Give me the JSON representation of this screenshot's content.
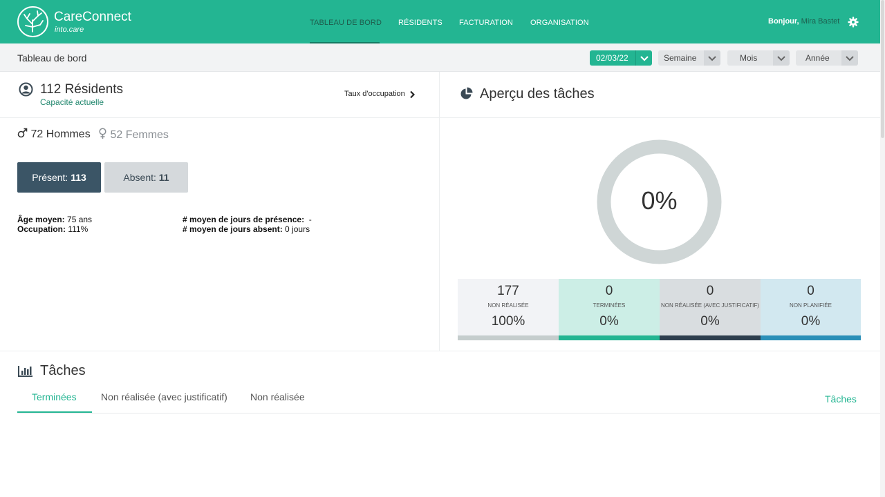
{
  "brand": {
    "name": "CareConnect",
    "sub": "into.care"
  },
  "nav": {
    "items": [
      {
        "label": "TABLEAU DE BORD",
        "active": true
      },
      {
        "label": "RÉSIDENTS",
        "active": false
      },
      {
        "label": "FACTURATION",
        "active": false
      },
      {
        "label": "ORGANISATION",
        "active": false
      }
    ]
  },
  "user": {
    "greeting": "Bonjour,",
    "name": "Mira Bastet"
  },
  "subbar": {
    "title": "Tableau de bord",
    "date": "02/03/22",
    "periods": [
      "Semaine",
      "Mois",
      "Année"
    ]
  },
  "residents": {
    "count_label": "112 Résidents",
    "capacity_label": "Capacité actuelle",
    "occupancy_link": "Taux d'occupation",
    "men": "72 Hommes",
    "women": "52 Femmes",
    "present_label": "Présent: ",
    "present_value": "113",
    "absent_label": "Absent: ",
    "absent_value": "11",
    "avg_age_label": "Âge moyen:",
    "avg_age_value": "75 ans",
    "occupation_label": "Occupation:",
    "occupation_value": "111%",
    "avg_presence_label": "# moyen de jours de présence:",
    "avg_presence_value": "-",
    "avg_absent_label": "# moyen de jours absent:",
    "avg_absent_value": "0 jours"
  },
  "overview": {
    "title": "Aperçu des tâches",
    "donut_label": "0%",
    "completion_fraction": 0,
    "tiles": [
      {
        "num": "177",
        "caption": "NON RÉALISÉE",
        "pct": "100%"
      },
      {
        "num": "0",
        "caption": "TERMINÉES",
        "pct": "0%"
      },
      {
        "num": "0",
        "caption": "NON RÉALISÉE (AVEC JUSTIFICATIF)",
        "pct": "0%"
      },
      {
        "num": "0",
        "caption": "NON PLANIFIÉE",
        "pct": "0%"
      }
    ]
  },
  "tasks": {
    "title": "Tâches",
    "tabs": [
      "Terminées",
      "Non réalisée (avec justificatif)",
      "Non réalisée"
    ],
    "link": "Tâches"
  },
  "colors": {
    "brand_green": "#23b592",
    "present_dark": "#3b5566",
    "donut_ring": "#cfd6d6",
    "tile_bars": [
      "#c5cdcd",
      "#23b592",
      "#2d3e4e",
      "#2a8fb8"
    ],
    "tile_bgs": [
      "#f2f3f6",
      "#cceee6",
      "#d9dde0",
      "#d2e8f0"
    ]
  }
}
